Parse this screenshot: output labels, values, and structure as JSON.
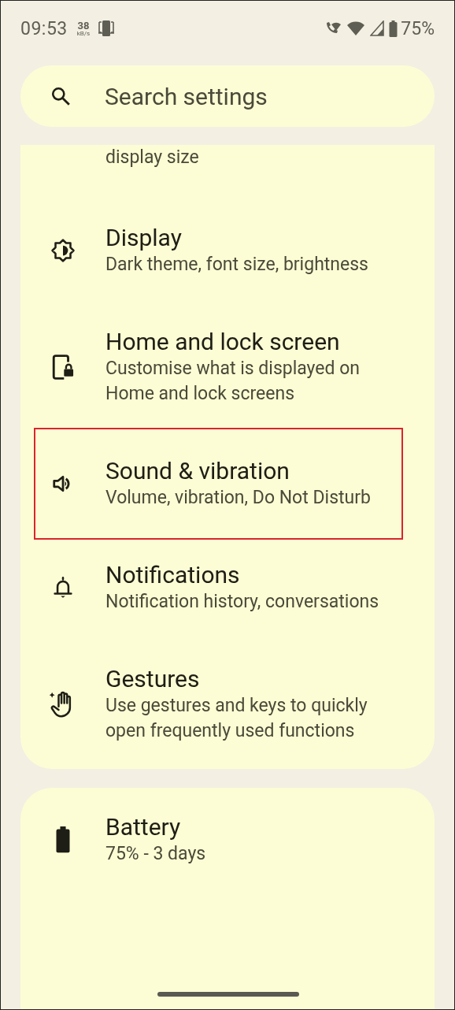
{
  "status_bar": {
    "time": "09:53",
    "speed_value": "38",
    "speed_unit": "kB/s",
    "battery": "75%"
  },
  "search": {
    "placeholder": "Search settings"
  },
  "groups": [
    {
      "items": [
        {
          "subtitle": "display size",
          "highlighted": false
        },
        {
          "title": "Display",
          "subtitle": "Dark theme, font size, brightness",
          "highlighted": false
        },
        {
          "title": "Home and lock screen",
          "subtitle": "Customise what is displayed on Home and lock screens",
          "highlighted": false
        },
        {
          "title": "Sound & vibration",
          "subtitle": "Volume, vibration, Do Not Disturb",
          "highlighted": true
        },
        {
          "title": "Notifications",
          "subtitle": "Notification history, conversations",
          "highlighted": false
        },
        {
          "title": "Gestures",
          "subtitle": "Use gestures and keys to quickly open frequently used functions",
          "highlighted": false
        }
      ]
    },
    {
      "items": [
        {
          "title": "Battery",
          "subtitle": "75% - 3 days",
          "highlighted": false
        }
      ]
    }
  ]
}
